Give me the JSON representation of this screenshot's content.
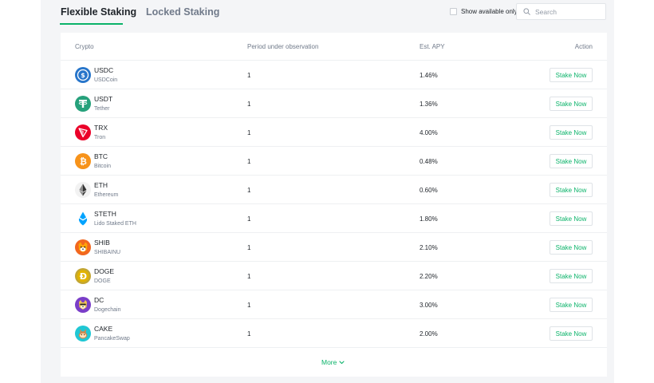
{
  "tabs": {
    "flexible": "Flexible Staking",
    "locked": "Locked Staking"
  },
  "filter": {
    "available_only_label": "Show available only",
    "checked": false
  },
  "search": {
    "placeholder": "Search",
    "value": "",
    "icon": "search-icon"
  },
  "table": {
    "headers": {
      "crypto": "Crypto",
      "period": "Period under observation",
      "apy": "Est. APY",
      "action": "Action"
    },
    "rows": [
      {
        "symbol": "USDC",
        "name": "USDCoin",
        "period": "1",
        "apy": "1.46%",
        "action": "Stake Now",
        "icon": "usdc-icon",
        "color": "#2775ca"
      },
      {
        "symbol": "USDT",
        "name": "Tether",
        "period": "1",
        "apy": "1.36%",
        "action": "Stake Now",
        "icon": "usdt-icon",
        "color": "#26a17b"
      },
      {
        "symbol": "TRX",
        "name": "Tron",
        "period": "1",
        "apy": "4.00%",
        "action": "Stake Now",
        "icon": "trx-icon",
        "color": "#eb0029"
      },
      {
        "symbol": "BTC",
        "name": "Bitcoin",
        "period": "1",
        "apy": "0.48%",
        "action": "Stake Now",
        "icon": "btc-icon",
        "color": "#f7931a"
      },
      {
        "symbol": "ETH",
        "name": "Ethereum",
        "period": "1",
        "apy": "0.60%",
        "action": "Stake Now",
        "icon": "eth-icon",
        "color": "#f2f2f2"
      },
      {
        "symbol": "STETH",
        "name": "Lido Staked ETH",
        "period": "1",
        "apy": "1.80%",
        "action": "Stake Now",
        "icon": "steth-icon",
        "color": "#00a3ff"
      },
      {
        "symbol": "SHIB",
        "name": "SHIBAINU",
        "period": "1",
        "apy": "2.10%",
        "action": "Stake Now",
        "icon": "shib-icon",
        "color": "#f2671f"
      },
      {
        "symbol": "DOGE",
        "name": "DOGE",
        "period": "1",
        "apy": "2.20%",
        "action": "Stake Now",
        "icon": "doge-icon",
        "color": "#c2a633"
      },
      {
        "symbol": "DC",
        "name": "Dogechain",
        "period": "1",
        "apy": "3.00%",
        "action": "Stake Now",
        "icon": "dogechain-icon",
        "color": "#7a3ec8"
      },
      {
        "symbol": "CAKE",
        "name": "PancakeSwap",
        "period": "1",
        "apy": "2.00%",
        "action": "Stake Now",
        "icon": "cake-icon",
        "color": "#1fc7d4"
      }
    ]
  },
  "more": {
    "label": "More",
    "icon": "chevron-down-icon"
  },
  "colors": {
    "accent": "#0bb36a",
    "text": "#1e2329",
    "muted": "#707a8a",
    "background": "#f4f5f7"
  }
}
